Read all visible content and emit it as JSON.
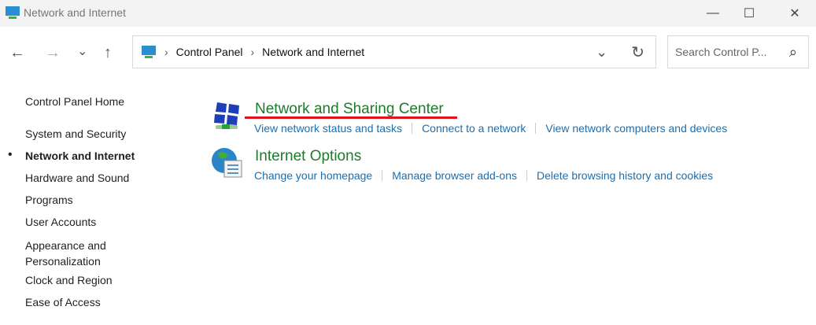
{
  "window": {
    "title": "Network and Internet",
    "minimize": "—",
    "maximize": "☐",
    "close": "✕"
  },
  "nav": {
    "back": "←",
    "forward": "→",
    "recent": "⌄",
    "up": "↑"
  },
  "address": {
    "crumbs": [
      "Control Panel",
      "Network and Internet"
    ],
    "sep": "›",
    "dropdown": "⌄",
    "refresh": "↻"
  },
  "search": {
    "placeholder": "Search Control P...",
    "icon": "⌕"
  },
  "sidebar": {
    "home": "Control Panel Home",
    "items": [
      "System and Security",
      "Network and Internet",
      "Hardware and Sound",
      "Programs",
      "User Accounts",
      "Appearance and Personalization",
      "Clock and Region",
      "Ease of Access"
    ],
    "active_index": 1,
    "bullet": "•"
  },
  "categories": [
    {
      "title": "Network and Sharing Center",
      "links": [
        "View network status and tasks",
        "Connect to a network",
        "View network computers and devices"
      ]
    },
    {
      "title": "Internet Options",
      "links": [
        "Change your homepage",
        "Manage browser add-ons",
        "Delete browsing history and cookies"
      ]
    }
  ],
  "colors": {
    "heading": "#1e7b2a",
    "link": "#1a6fb0",
    "annotation": "#e0141e"
  }
}
